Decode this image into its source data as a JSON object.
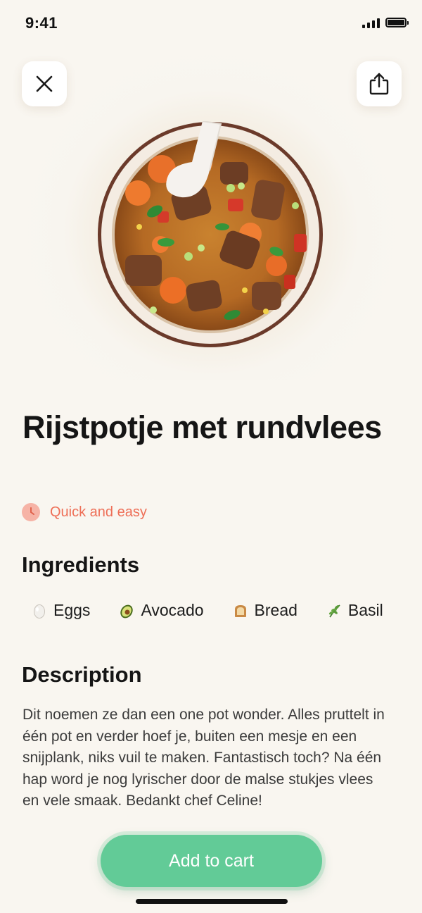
{
  "status_bar": {
    "time": "9:41"
  },
  "header": {
    "close_icon": "close-x-icon",
    "share_icon": "share-upload-icon"
  },
  "recipe": {
    "title": "Rijstpotje met rundvlees",
    "tag": {
      "icon": "clock-icon",
      "label": "Quick and easy",
      "color": "#ee6f57"
    }
  },
  "ingredients": {
    "heading": "Ingredients",
    "items": [
      {
        "icon": "egg-icon",
        "label": "Eggs"
      },
      {
        "icon": "avocado-icon",
        "label": "Avocado"
      },
      {
        "icon": "bread-icon",
        "label": "Bread"
      },
      {
        "icon": "basil-icon",
        "label": "Basil"
      }
    ]
  },
  "description": {
    "heading": "Description",
    "text": "Dit noemen ze dan een one pot wonder. Alles pruttelt in één pot en verder hoef je, buiten een mesje en een snijplank, niks vuil te maken. Fantastisch toch? Na één hap word je nog lyrischer door de malse stukjes vlees en vele smaak. Bedankt chef Celine!"
  },
  "cta": {
    "label": "Add to cart",
    "color": "#62cb97"
  },
  "colors": {
    "background": "#f9f6f0",
    "accent": "#ee6f57",
    "primary_button": "#62cb97"
  }
}
